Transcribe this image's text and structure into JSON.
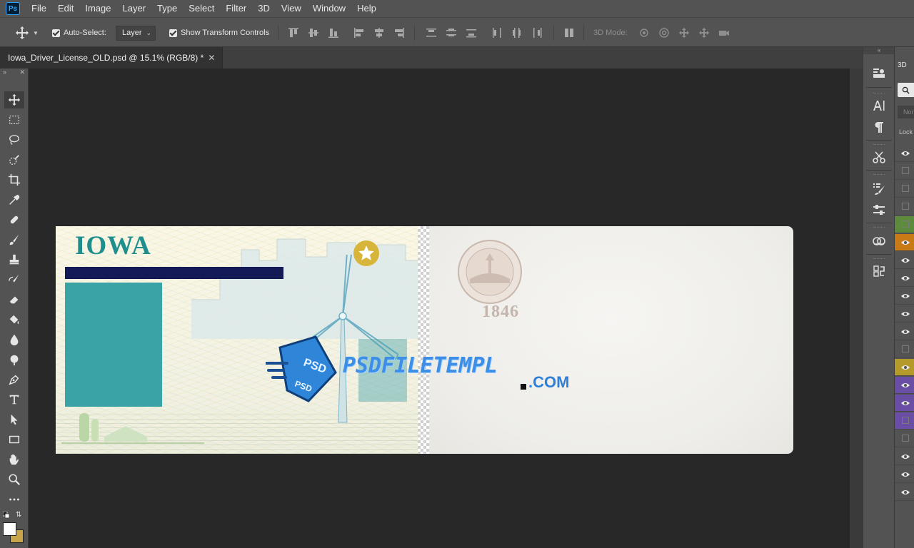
{
  "app": {
    "logo": "Ps"
  },
  "menu": [
    "File",
    "Edit",
    "Image",
    "Layer",
    "Type",
    "Select",
    "Filter",
    "3D",
    "View",
    "Window",
    "Help"
  ],
  "options": {
    "auto_select_label": "Auto-Select:",
    "auto_select_checked": true,
    "auto_select_value": "Layer",
    "show_transform_label": "Show Transform Controls",
    "show_transform_checked": true,
    "mode_3d_label": "3D Mode:"
  },
  "document": {
    "tab_title": "Iowa_Driver_License_OLD.psd @ 15.1% (RGB/8) *",
    "close_glyph": "✕"
  },
  "tools": [
    "move-tool",
    "marquee-tool",
    "lasso-tool",
    "quick-select-tool",
    "crop-tool",
    "eyedropper-tool",
    "healing-brush-tool",
    "brush-tool",
    "clone-stamp-tool",
    "history-brush-tool",
    "eraser-tool",
    "paint-bucket-tool",
    "blur-tool",
    "dodge-tool",
    "pen-tool",
    "type-tool",
    "path-select-tool",
    "rectangle-tool",
    "hand-tool",
    "zoom-tool",
    "more-tools"
  ],
  "canvas": {
    "front": {
      "state_name": "IOWA"
    },
    "back": {
      "seal_year": "1846"
    },
    "watermark": {
      "text": "PSDFILETEMPL",
      "suffix": ".COM",
      "badge_text_top": "PSD",
      "badge_text_bottom": "PSD"
    }
  },
  "right_panel": {
    "tab_label": "3D",
    "blend_placeholder": "Nor",
    "lock_label": "Lock"
  },
  "colors": {
    "foreground": "#ffffff",
    "background": "#c8a54a",
    "layer_tags": [
      "none",
      "none",
      "none",
      "none",
      "#5e8a3e",
      "#c87a16",
      "none",
      "none",
      "none",
      "none",
      "none",
      "none",
      "#b49a2a",
      "#6a4ea6",
      "#6a4ea6",
      "#6a4ea6",
      "none",
      "none",
      "none",
      "none"
    ]
  }
}
